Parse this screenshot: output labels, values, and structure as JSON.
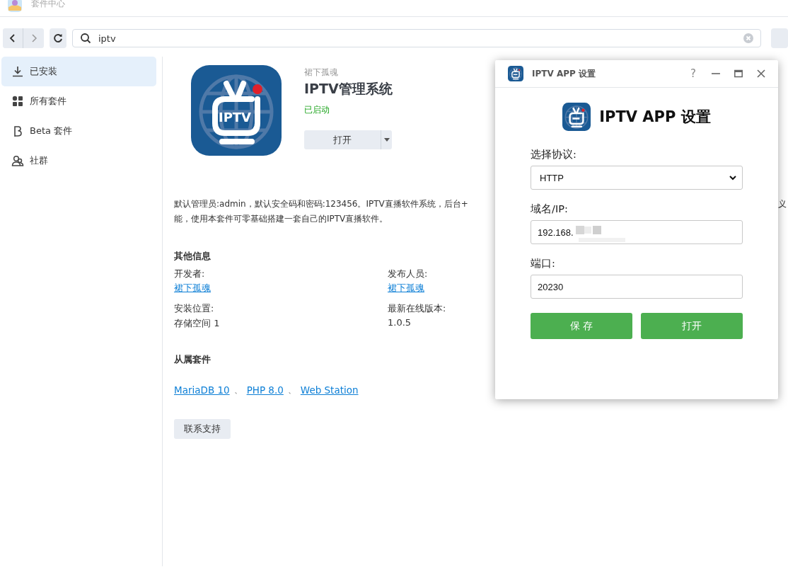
{
  "window": {
    "title": "套件中心"
  },
  "toolbar": {
    "search": {
      "value": "iptv"
    }
  },
  "sidebar": {
    "items": [
      {
        "label": "已安装",
        "kind": "download",
        "selected": true
      },
      {
        "label": "所有套件",
        "kind": "grid",
        "selected": false
      },
      {
        "label": "Beta 套件",
        "kind": "beta",
        "selected": false
      },
      {
        "label": "社群",
        "kind": "people",
        "selected": false
      }
    ]
  },
  "package": {
    "logo_text": "IPTV",
    "publisher": "裙下孤魂",
    "name": "IPTV管理系统",
    "status": "已启动",
    "running": true,
    "open_button": "打开",
    "description_lines": [
      "默认管理员:admin，默认安全码和密码:123456。IPTV直播软件系统，后台+",
      "能，使用本套件可零基础搭建一套自己的IPTV直播软件。"
    ],
    "description_tail": "义",
    "other_info_title": "其他信息",
    "info": [
      {
        "label": "开发者:",
        "value": "裙下孤魂",
        "kind": "link"
      },
      {
        "label": "发布人员:",
        "value": "裙下孤魂",
        "kind": "link"
      },
      {
        "label": "安装位置:",
        "value": "存储空间 1",
        "kind": "text"
      },
      {
        "label": "最新在线版本:",
        "value": "1.0.5",
        "kind": "text"
      }
    ],
    "dependencies_title": "从属套件",
    "dependencies": [
      "MariaDB 10",
      "PHP 8.0",
      "Web Station"
    ],
    "separator": "、",
    "support_button": "联系支持"
  },
  "dialog": {
    "title": "IPTV APP 设置",
    "help": "?",
    "heading": "IPTV APP 设置",
    "fields": [
      {
        "label": "选择协议:",
        "kind": "select",
        "value": "HTTP"
      },
      {
        "label": "域名/IP:",
        "kind": "input",
        "value": "192.168.",
        "blurred": true
      },
      {
        "label": "端口:",
        "kind": "input",
        "value": "20230",
        "blurred": false
      }
    ],
    "buttons": [
      "保 存",
      "打开"
    ]
  }
}
